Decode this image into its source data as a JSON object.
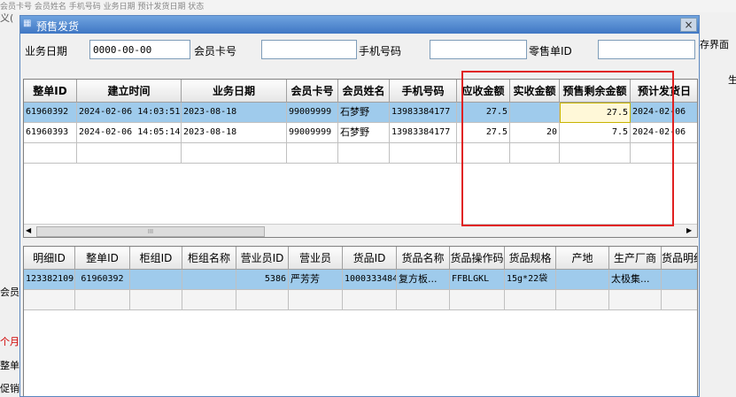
{
  "background": {
    "top_text": "会员卡号 会员姓名 手机号码 业务日期 预计发货日期 状态",
    "tab_label": "义(",
    "right_text_1": "存界面",
    "right_text_2": "生",
    "left_labels": [
      "会员",
      "个月",
      "整单",
      "促销"
    ]
  },
  "dialog": {
    "title": "预售发货",
    "close_icon": "×",
    "filters": {
      "business_date_label": "业务日期",
      "business_date_value": "0000-00-00",
      "member_card_label": "会员卡号",
      "member_card_value": "",
      "phone_label": "手机号码",
      "phone_value": "",
      "sale_id_label": "零售单ID",
      "sale_id_value": ""
    },
    "orders": {
      "columns": [
        "整单ID",
        "建立时间",
        "业务日期",
        "会员卡号",
        "会员姓名",
        "手机号码",
        "应收金额",
        "实收金额",
        "预售剩余金额",
        "预计发货日"
      ],
      "rows": [
        [
          "61960392",
          "2024-02-06 14:03:51",
          "2023-08-18",
          "99009999",
          "石梦野",
          "13983384177",
          "27.5",
          "",
          "27.5",
          "2024-02-06"
        ],
        [
          "61960393",
          "2024-02-06 14:05:14",
          "2023-08-18",
          "99009999",
          "石梦野",
          "13983384177",
          "27.5",
          "20",
          "7.5",
          "2024-02-06"
        ]
      ]
    },
    "details": {
      "columns": [
        "明细ID",
        "整单ID",
        "柜组ID",
        "柜组名称",
        "营业员ID",
        "营业员",
        "货品ID",
        "货品名称",
        "货品操作码",
        "货品规格",
        "产地",
        "生产厂商",
        "货品明细"
      ],
      "rows": [
        [
          "123382109",
          "61960392",
          "",
          "",
          "5386",
          "严芳芳",
          "1000333484",
          "复方板...",
          "FFBLGKL",
          "15g*22袋",
          "",
          "太极集...",
          ""
        ]
      ]
    },
    "scroll_mark": "III"
  }
}
